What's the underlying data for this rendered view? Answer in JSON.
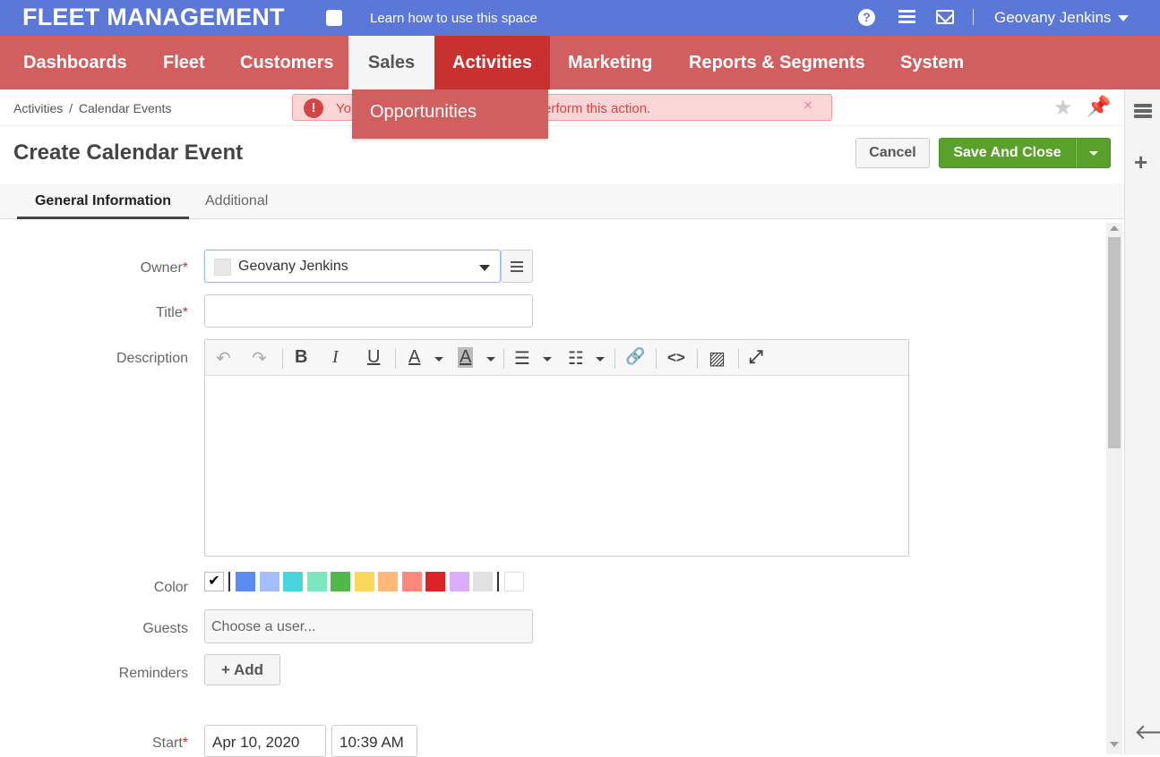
{
  "topbar": {
    "app_title": "FLEET MANAGEMENT",
    "learn_link": "Learn how to use this space",
    "help_glyph": "?",
    "user_name": "Geovany Jenkins",
    "icons": [
      "share-icon",
      "help-icon",
      "menu-icon",
      "mail-icon",
      "caret-down-icon"
    ]
  },
  "nav": {
    "items": [
      "Dashboards",
      "Fleet",
      "Customers",
      "Sales",
      "Activities",
      "Marketing",
      "Reports & Segments",
      "System"
    ],
    "open_item": "Sales",
    "dropdown_items": [
      "Opportunities"
    ],
    "colors": {
      "bar": "#d25f5f",
      "active": "#c93131",
      "open": "#f5f5f5"
    }
  },
  "breadcrumb": {
    "items": [
      "Activities",
      "Calendar Events"
    ],
    "separator": "/"
  },
  "alert": {
    "text_start": "Yo",
    "text_end": "erform this action.",
    "close": "×",
    "icon": "exclamation-icon",
    "color": "#d64545"
  },
  "page": {
    "title": "Create Calendar Event",
    "cancel_label": "Cancel",
    "save_label": "Save And Close",
    "save_color": "#5aa12c"
  },
  "tabs": [
    {
      "label": "General Information",
      "active": true
    },
    {
      "label": "Additional",
      "active": false
    }
  ],
  "form": {
    "owner": {
      "label": "Owner",
      "required": "*",
      "value": "Geovany Jenkins"
    },
    "title": {
      "label": "Title",
      "required": "*",
      "value": ""
    },
    "description": {
      "label": "Description",
      "toolbar_icons": [
        "undo-icon",
        "redo-icon",
        "bold-icon",
        "italic-icon",
        "underline-icon",
        "text-color-icon",
        "background-color-icon",
        "bullet-list-icon",
        "numbered-list-icon",
        "link-icon",
        "code-icon",
        "image-icon",
        "fullscreen-icon"
      ],
      "glyphs": {
        "undo": "↶",
        "redo": "↷",
        "bold": "B",
        "italic": "I",
        "underline": "U",
        "text_color": "A",
        "bg_color": "A",
        "bullets": "☰",
        "numbers": "☷",
        "link": "🔗",
        "code": "<>",
        "image": "▨",
        "fullscreen": "⤢"
      }
    },
    "color": {
      "label": "Color",
      "check_glyph": "✔",
      "swatches": [
        "#5b8def",
        "#a4bdfc",
        "#46d6db",
        "#7ae7bf",
        "#51b749",
        "#fbd75b",
        "#ffb878",
        "#ff887c",
        "#dc2127",
        "#dbadff",
        "#e1e1e1"
      ],
      "custom": "#ffffff"
    },
    "guests": {
      "label": "Guests",
      "placeholder": "Choose a user..."
    },
    "reminders": {
      "label": "Reminders",
      "add_label": "+ Add"
    },
    "start": {
      "label": "Start",
      "required": "*",
      "date": "Apr 10, 2020",
      "time": "10:39 AM"
    }
  },
  "right_rail": {
    "icons": [
      "sidebar-list-icon",
      "plus-icon",
      "arrow-left-icon"
    ],
    "plus_glyph": "+",
    "back_glyph": "🡐"
  },
  "misc": {
    "star_glyph": "★",
    "pin_glyph": "📌"
  }
}
